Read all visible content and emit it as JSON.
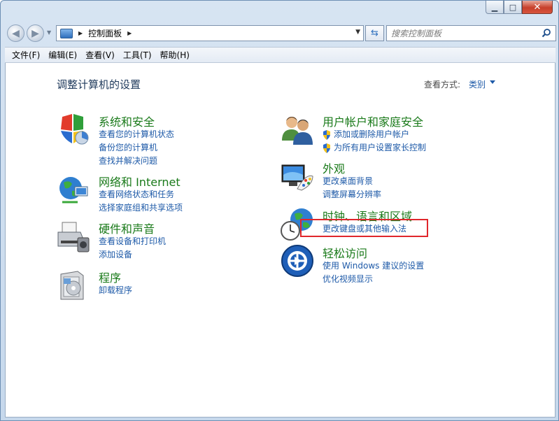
{
  "window": {
    "caption_min": "▁",
    "caption_max": "□",
    "caption_close": "✕"
  },
  "nav": {
    "back_glyph": "◀",
    "fwd_glyph": "▶"
  },
  "address": {
    "crumb": "控制面板"
  },
  "search": {
    "placeholder": "搜索控制面板"
  },
  "menu": [
    "文件(F)",
    "编辑(E)",
    "查看(V)",
    "工具(T)",
    "帮助(H)"
  ],
  "page": {
    "title": "调整计算机的设置",
    "view_by_label": "查看方式:",
    "view_by_value": "类别"
  },
  "categories": {
    "system_security": {
      "title": "系统和安全",
      "links": [
        "查看您的计算机状态",
        "备份您的计算机",
        "查找并解决问题"
      ]
    },
    "network": {
      "title": "网络和 Internet",
      "links": [
        "查看网络状态和任务",
        "选择家庭组和共享选项"
      ]
    },
    "hardware": {
      "title": "硬件和声音",
      "links": [
        "查看设备和打印机",
        "添加设备"
      ]
    },
    "programs": {
      "title": "程序",
      "links": [
        "卸载程序"
      ]
    },
    "user_accounts": {
      "title": "用户帐户和家庭安全",
      "links": [
        "添加或删除用户帐户",
        "为所有用户设置家长控制"
      ]
    },
    "appearance": {
      "title": "外观",
      "links": [
        "更改桌面背景",
        "调整屏幕分辨率"
      ]
    },
    "clock_region": {
      "title": "时钟、语言和区域",
      "links": [
        "更改键盘或其他输入法"
      ]
    },
    "ease_access": {
      "title": "轻松访问",
      "links": [
        "使用 Windows 建议的设置",
        "优化视频显示"
      ]
    }
  },
  "icons": {
    "system_security": "shield-icon",
    "network": "globe-network-icon",
    "hardware": "printer-icon",
    "programs": "program-box-icon",
    "user_accounts": "users-icon",
    "appearance": "monitor-palette-icon",
    "clock_region": "clock-globe-icon",
    "ease_access": "ease-of-access-icon",
    "uac_shield": "uac-shield-icon"
  },
  "colors": {
    "category_title": "#1a7a1a",
    "link": "#1e5aa8",
    "highlight": "#e0262b"
  }
}
